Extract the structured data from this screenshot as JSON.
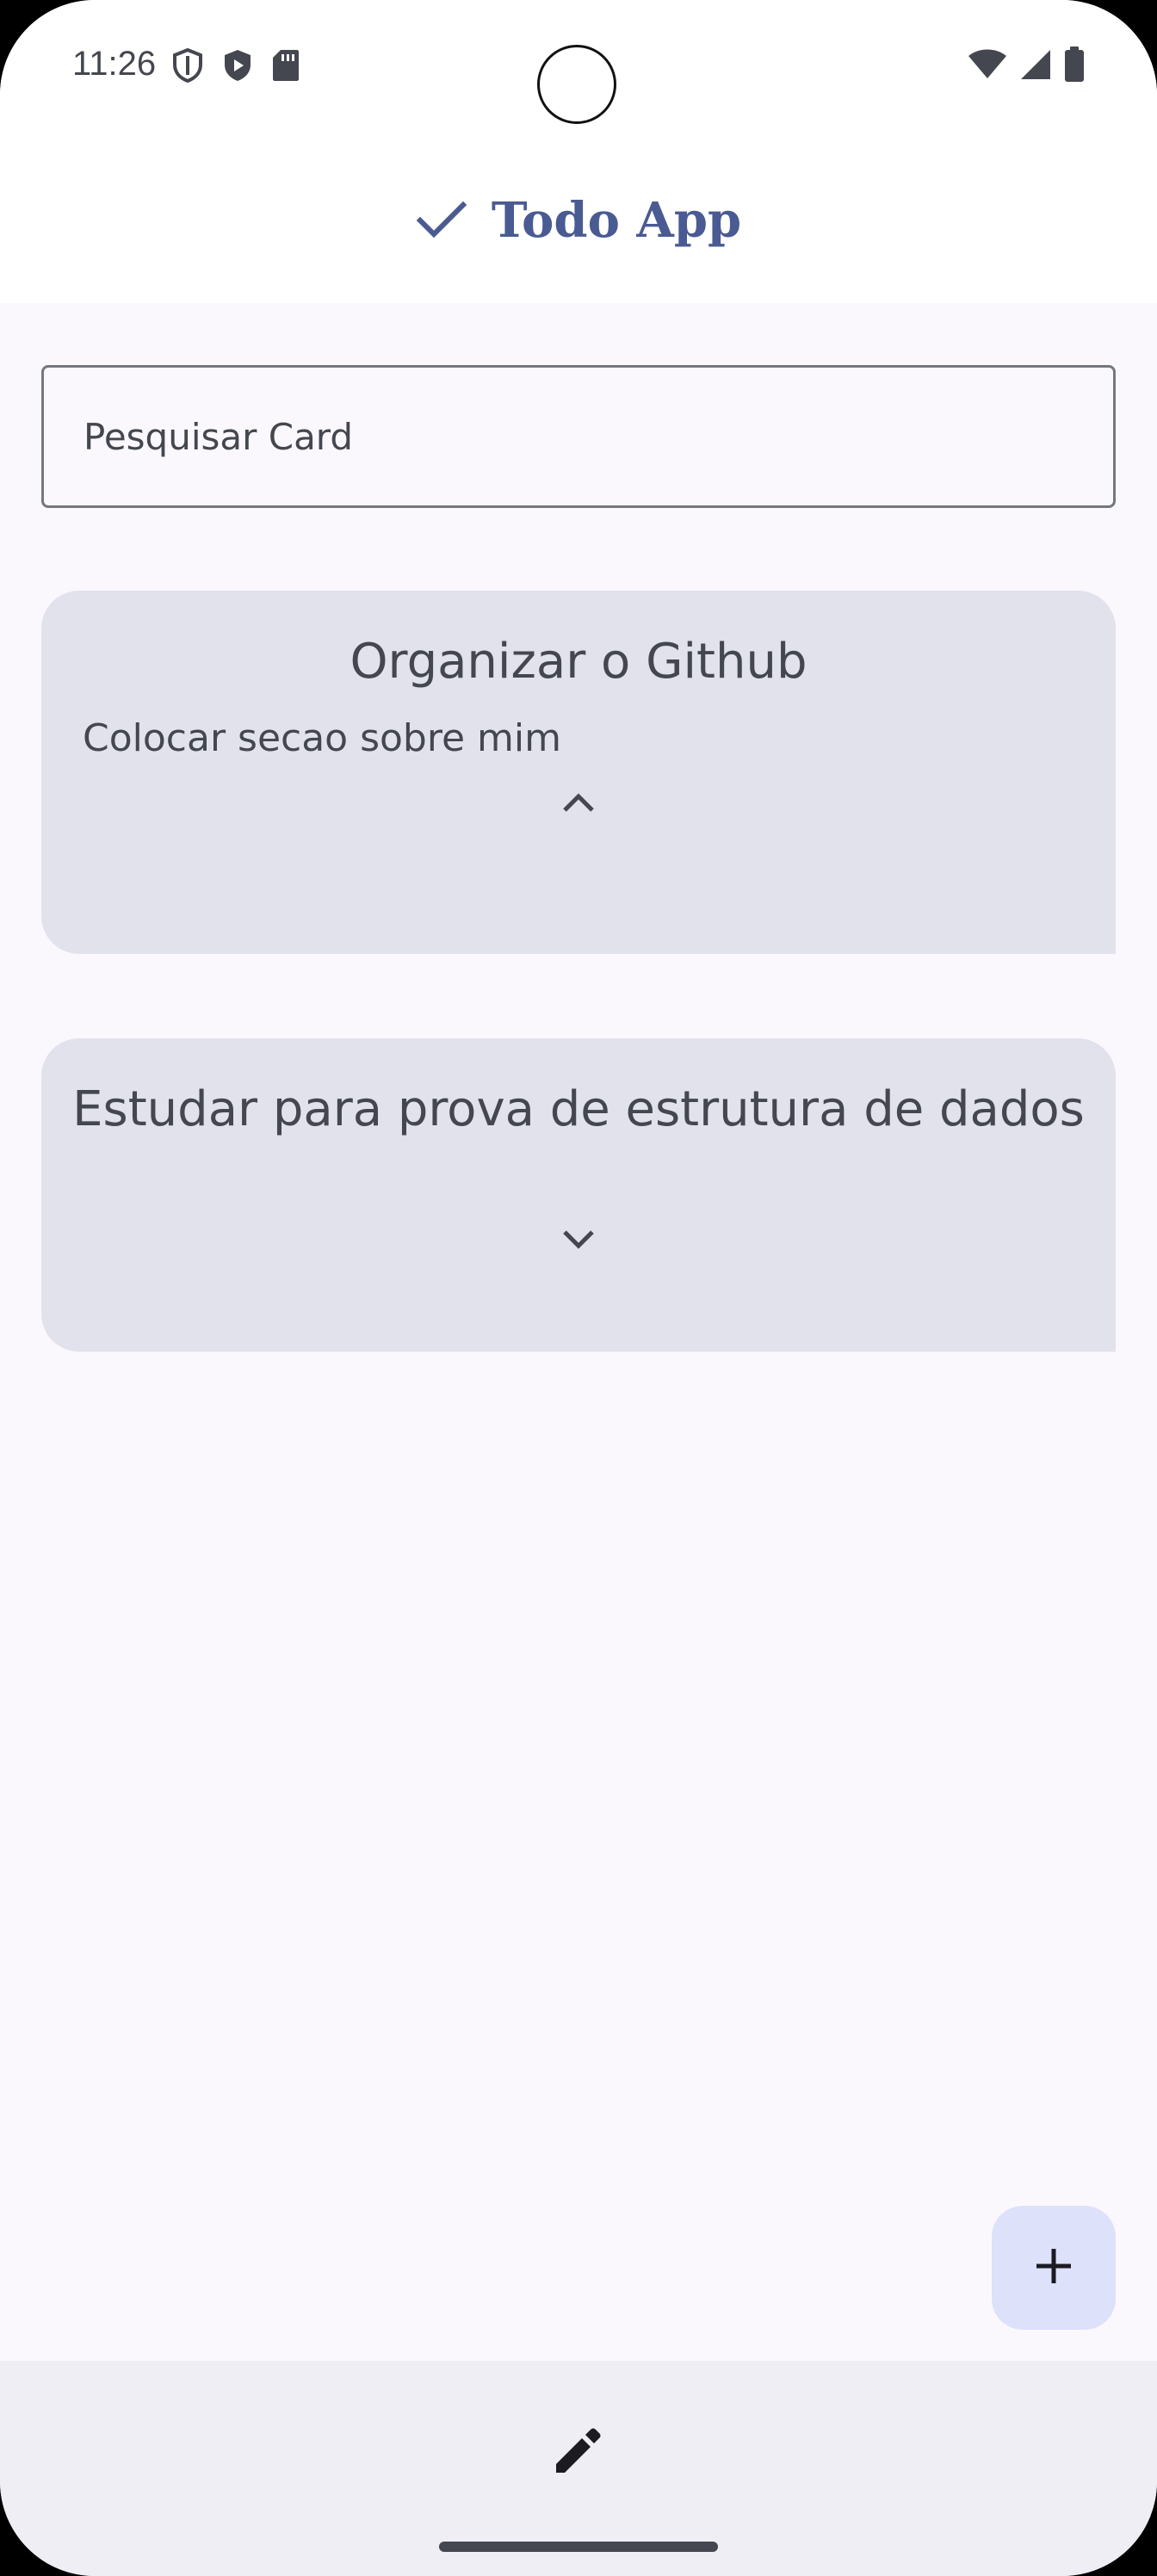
{
  "status_bar": {
    "time": "11:26",
    "icons_left": [
      "shield-icon",
      "play-protect-icon",
      "sd-card-icon"
    ],
    "icons_right": [
      "wifi-icon",
      "cellular-signal-icon",
      "battery-icon"
    ]
  },
  "app_bar": {
    "icon": "check-icon",
    "title": "Todo App"
  },
  "search": {
    "placeholder": "Pesquisar Card",
    "value": ""
  },
  "cards": [
    {
      "title": "Organizar o Github",
      "description": "Colocar secao sobre mim",
      "expanded": true,
      "toggle_icon": "chevron-up-icon"
    },
    {
      "title": "Estudar para prova de estrutura de dados",
      "description": "",
      "expanded": false,
      "toggle_icon": "chevron-down-icon"
    }
  ],
  "fab": {
    "icon": "plus-icon"
  },
  "bottom_bar": {
    "icon": "edit-icon"
  },
  "colors": {
    "primary": "#4a5a92",
    "card_background": "#e1e2ec",
    "surface": "#fbf8fd",
    "fab_background": "#dde1fa",
    "on_surface_variant": "#44474f"
  }
}
